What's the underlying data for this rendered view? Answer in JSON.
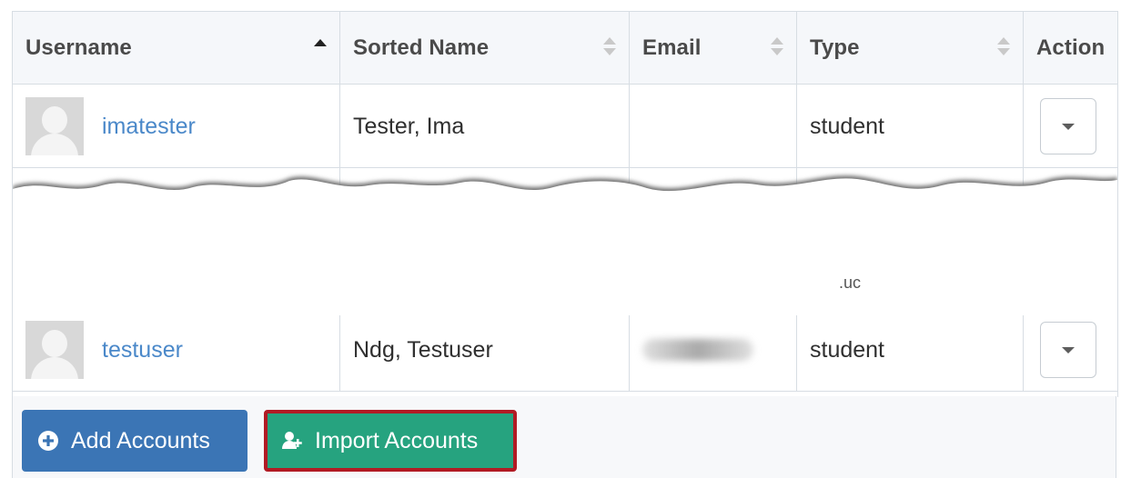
{
  "table": {
    "headers": [
      {
        "label": "Username",
        "sort": "asc"
      },
      {
        "label": "Sorted Name",
        "sort": "none"
      },
      {
        "label": "Email",
        "sort": "none"
      },
      {
        "label": "Type",
        "sort": "none"
      },
      {
        "label": "Action",
        "sort": "none"
      }
    ],
    "rows": [
      {
        "username": "imatester",
        "sorted_name": "Tester, Ima",
        "email": "",
        "type": "student"
      },
      {
        "username": "testuser",
        "sorted_name": "Ndg, Testuser",
        "email": "",
        "type": "student"
      }
    ]
  },
  "toolbar": {
    "add_accounts_label": "Add Accounts",
    "import_accounts_label": "Import Accounts"
  },
  "colors": {
    "link": "#4a88c9",
    "add_button": "#3b75b5",
    "import_button": "#26a37f",
    "highlight_border": "#b11b24"
  },
  "icons": {
    "sort_active": "caret-up-icon",
    "sort_inactive": "sort-icon",
    "row_action": "chevron-down-icon",
    "add": "plus-circle-icon",
    "import": "user-plus-icon"
  }
}
